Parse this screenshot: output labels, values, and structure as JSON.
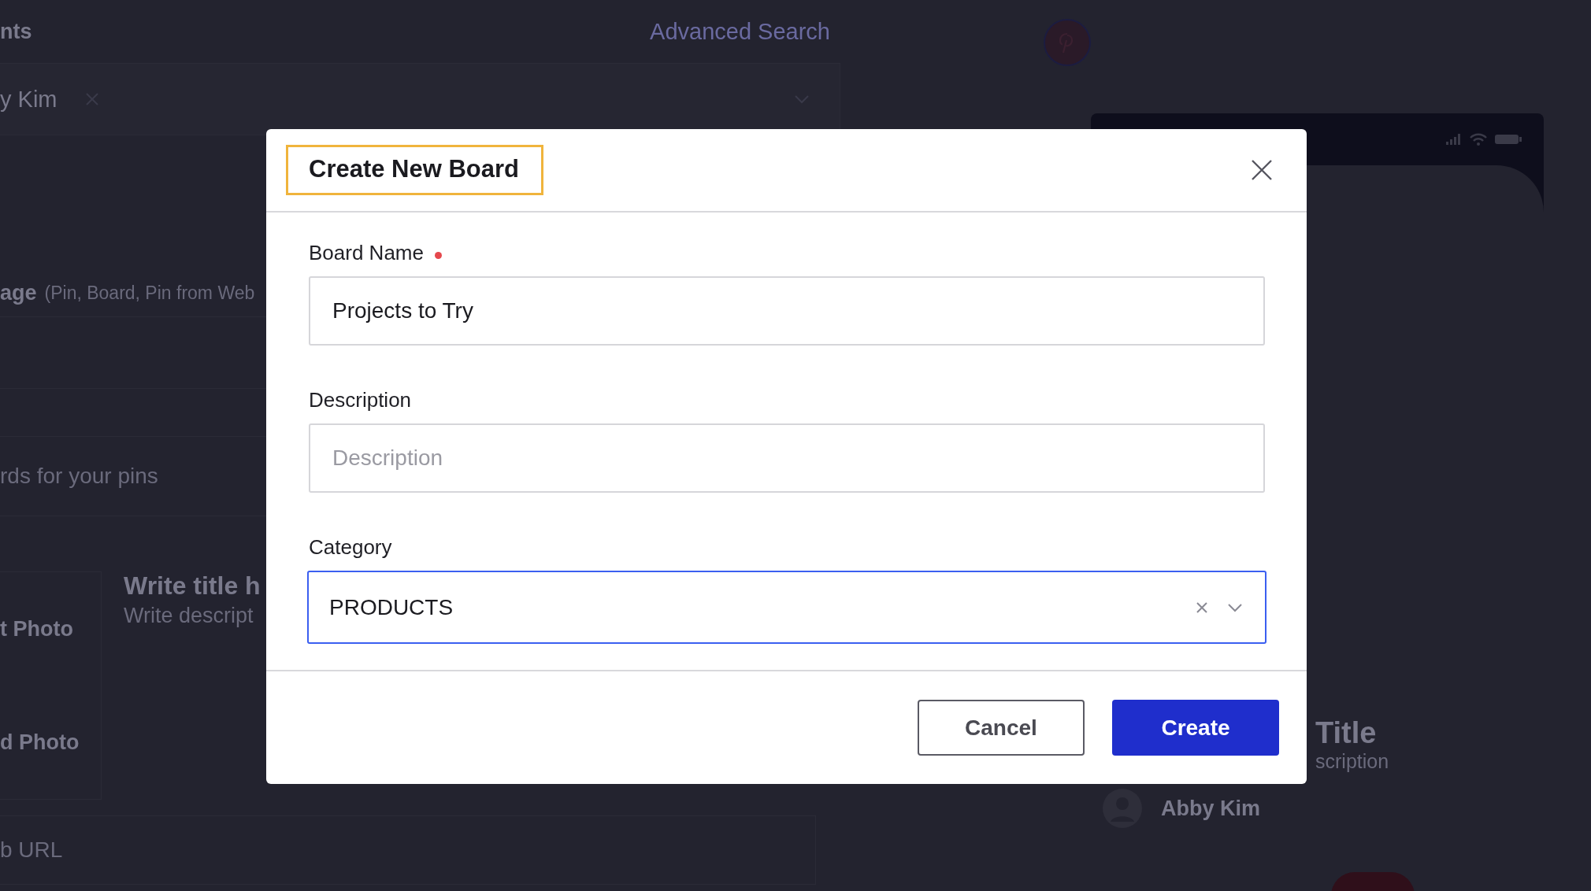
{
  "background": {
    "header_label": "nts",
    "advanced_search": "Advanced Search",
    "selected_chip": "y Kim",
    "page_type_label": "age",
    "page_type_hint": "(Pin, Board, Pin from Web",
    "boards_placeholder": "rds for your pins",
    "photo_options": [
      "t Photo",
      "d Photo"
    ],
    "pin_title": "Write title h",
    "pin_description": "Write descript",
    "web_url_placeholder": "b URL",
    "preview": {
      "title": "Title",
      "description": "scription",
      "author": "Abby Kim"
    }
  },
  "dialog": {
    "title": "Create New Board",
    "fields": [
      {
        "kind": "text",
        "label": "Board Name",
        "required": true,
        "value": "Projects to Try",
        "focused": false
      },
      {
        "kind": "text",
        "label": "Description",
        "placeholder": "Description",
        "required": false,
        "focused": false
      },
      {
        "kind": "select",
        "label": "Category",
        "value": "PRODUCTS",
        "required": false,
        "focused": true
      }
    ],
    "buttons": [
      {
        "label": "Cancel",
        "kind": "secondary"
      },
      {
        "label": "Create",
        "kind": "primary"
      }
    ]
  }
}
